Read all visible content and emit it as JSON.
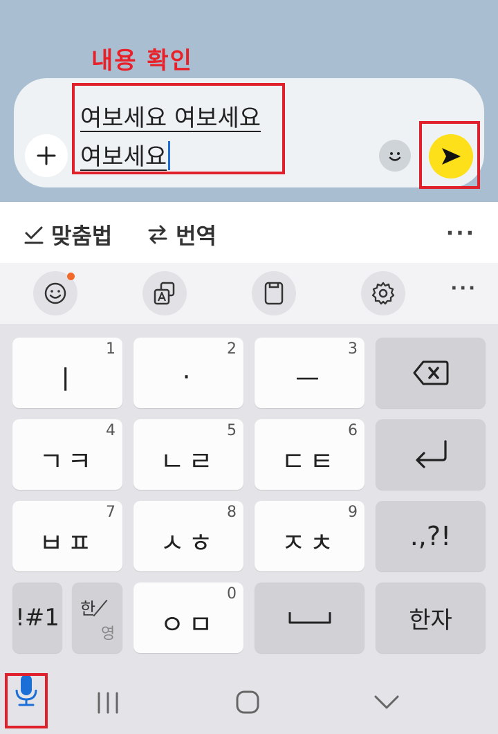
{
  "annotation": {
    "title": "내용 확인"
  },
  "chat": {
    "message_line1": "여보세요 여보세요",
    "message_line2": "여보세요"
  },
  "suggestions": {
    "spellcheck": "맞춤법",
    "translate": "번역",
    "more": "···"
  },
  "toolbar": {
    "more": "···"
  },
  "keyboard": {
    "rows": [
      [
        {
          "label": "ㅣ",
          "num": "1"
        },
        {
          "label": "·",
          "num": "2"
        },
        {
          "label": "ㅡ",
          "num": "3"
        }
      ],
      [
        {
          "label": "ㄱㅋ",
          "num": "4"
        },
        {
          "label": "ㄴㄹ",
          "num": "5"
        },
        {
          "label": "ㄷㅌ",
          "num": "6"
        }
      ],
      [
        {
          "label": "ㅂㅍ",
          "num": "7"
        },
        {
          "label": "ㅅㅎ",
          "num": "8"
        },
        {
          "label": "ㅈㅊ",
          "num": "9"
        }
      ]
    ],
    "punct": ".,?!",
    "symbols": "!#1",
    "lang_top": "한",
    "lang_bottom": "영",
    "zero_key": {
      "label": "ㅇㅁ",
      "num": "0"
    },
    "hanja": "한자"
  },
  "colors": {
    "chat_bg": "#a9bfd1",
    "annotation_red": "#e0202a",
    "send_yellow": "#fde01a",
    "caret_blue": "#1b6fd6",
    "mic_blue": "#1b6fd6"
  },
  "icons": [
    "plus-icon",
    "emoji-icon",
    "send-icon",
    "check-icon",
    "swap-icon",
    "emoji-face-icon",
    "translate-icon",
    "clipboard-icon",
    "gear-icon",
    "backspace-icon",
    "enter-icon",
    "space-icon",
    "mic-icon",
    "recents-icon",
    "home-icon",
    "back-icon"
  ]
}
